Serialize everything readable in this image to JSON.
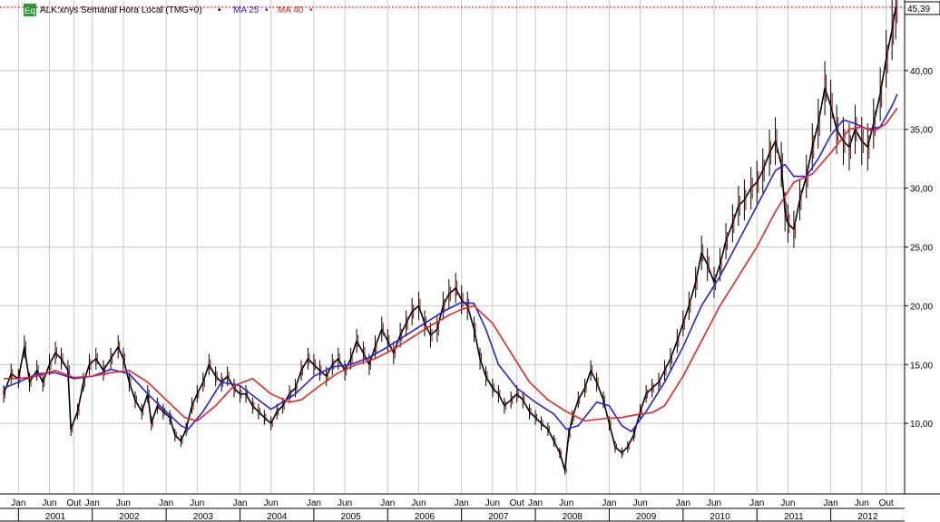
{
  "chart_data": {
    "type": "line",
    "title": "ALK:xnys Semanal Hora Local (TMG+0)",
    "badge": "Eq",
    "last_price": 45.39,
    "last_price_label": "45,39",
    "ylim": [
      4,
      46
    ],
    "y_ticks": [
      10,
      15,
      20,
      25,
      30,
      35,
      40
    ],
    "y_tick_labels": [
      "10,00",
      "15,00",
      "20,00",
      "25,00",
      "30,00",
      "35,00",
      "40,00"
    ],
    "xlim": [
      2000.75,
      2013.0
    ],
    "month_ticks": [
      {
        "label": "Jan",
        "x": 2001.0
      },
      {
        "label": "Jun",
        "x": 2001.42
      },
      {
        "label": "Out",
        "x": 2001.75
      },
      {
        "label": "Jan",
        "x": 2002.0
      },
      {
        "label": "Jun",
        "x": 2002.42
      },
      {
        "label": "Jan",
        "x": 2003.0
      },
      {
        "label": "Jun",
        "x": 2003.42
      },
      {
        "label": "Jan",
        "x": 2004.0
      },
      {
        "label": "Jun",
        "x": 2004.42
      },
      {
        "label": "Jan",
        "x": 2005.0
      },
      {
        "label": "Jun",
        "x": 2005.42
      },
      {
        "label": "Jan",
        "x": 2006.0
      },
      {
        "label": "Jun",
        "x": 2006.42
      },
      {
        "label": "Jan",
        "x": 2007.0
      },
      {
        "label": "Jun",
        "x": 2007.42
      },
      {
        "label": "Out",
        "x": 2007.75
      },
      {
        "label": "Jan",
        "x": 2008.0
      },
      {
        "label": "Jun",
        "x": 2008.42
      },
      {
        "label": "Jan",
        "x": 2009.0
      },
      {
        "label": "Jun",
        "x": 2009.42
      },
      {
        "label": "Jan",
        "x": 2010.0
      },
      {
        "label": "Jun",
        "x": 2010.42
      },
      {
        "label": "Jan",
        "x": 2011.0
      },
      {
        "label": "Jun",
        "x": 2011.42
      },
      {
        "label": "Jan",
        "x": 2012.0
      },
      {
        "label": "Jun",
        "x": 2012.42
      },
      {
        "label": "Out",
        "x": 2012.75
      }
    ],
    "years": [
      "2001",
      "2002",
      "2003",
      "2004",
      "2005",
      "2006",
      "2007",
      "2008",
      "2009",
      "2010",
      "2011",
      "2012"
    ],
    "series": [
      {
        "name": "ALK:xnys",
        "style": "bars",
        "color": "#000000",
        "points": [
          [
            2000.8,
            12.5
          ],
          [
            2000.9,
            14.2
          ],
          [
            2001.0,
            13.8
          ],
          [
            2001.08,
            16.5
          ],
          [
            2001.15,
            13.5
          ],
          [
            2001.25,
            14.5
          ],
          [
            2001.33,
            13.5
          ],
          [
            2001.42,
            15.0
          ],
          [
            2001.5,
            16.0
          ],
          [
            2001.58,
            15.5
          ],
          [
            2001.67,
            14.5
          ],
          [
            2001.71,
            9.5
          ],
          [
            2001.8,
            11.0
          ],
          [
            2001.88,
            13.5
          ],
          [
            2001.96,
            15.0
          ],
          [
            2002.05,
            15.5
          ],
          [
            2002.15,
            14.5
          ],
          [
            2002.25,
            15.5
          ],
          [
            2002.35,
            16.5
          ],
          [
            2002.42,
            15.5
          ],
          [
            2002.5,
            13.5
          ],
          [
            2002.58,
            12.0
          ],
          [
            2002.67,
            11.0
          ],
          [
            2002.75,
            12.5
          ],
          [
            2002.8,
            10.0
          ],
          [
            2002.88,
            11.5
          ],
          [
            2002.96,
            11.0
          ],
          [
            2003.05,
            10.5
          ],
          [
            2003.12,
            9.0
          ],
          [
            2003.2,
            8.5
          ],
          [
            2003.27,
            9.5
          ],
          [
            2003.35,
            11.5
          ],
          [
            2003.42,
            12.5
          ],
          [
            2003.5,
            13.5
          ],
          [
            2003.58,
            15.0
          ],
          [
            2003.67,
            14.0
          ],
          [
            2003.75,
            13.5
          ],
          [
            2003.83,
            14.0
          ],
          [
            2003.92,
            13.0
          ],
          [
            2004.0,
            12.5
          ],
          [
            2004.08,
            12.5
          ],
          [
            2004.17,
            11.5
          ],
          [
            2004.25,
            11.0
          ],
          [
            2004.33,
            10.5
          ],
          [
            2004.42,
            10.0
          ],
          [
            2004.5,
            11.0
          ],
          [
            2004.58,
            11.5
          ],
          [
            2004.67,
            12.5
          ],
          [
            2004.75,
            13.0
          ],
          [
            2004.83,
            14.5
          ],
          [
            2004.92,
            15.5
          ],
          [
            2005.0,
            15.0
          ],
          [
            2005.08,
            14.5
          ],
          [
            2005.17,
            14.0
          ],
          [
            2005.25,
            15.0
          ],
          [
            2005.33,
            15.5
          ],
          [
            2005.42,
            14.5
          ],
          [
            2005.5,
            15.5
          ],
          [
            2005.58,
            17.0
          ],
          [
            2005.67,
            16.0
          ],
          [
            2005.75,
            15.0
          ],
          [
            2005.83,
            16.5
          ],
          [
            2005.92,
            18.0
          ],
          [
            2006.0,
            17.0
          ],
          [
            2006.08,
            16.0
          ],
          [
            2006.17,
            17.5
          ],
          [
            2006.25,
            18.5
          ],
          [
            2006.33,
            19.5
          ],
          [
            2006.42,
            20.0
          ],
          [
            2006.5,
            18.5
          ],
          [
            2006.58,
            17.5
          ],
          [
            2006.67,
            18.0
          ],
          [
            2006.75,
            20.0
          ],
          [
            2006.83,
            21.0
          ],
          [
            2006.92,
            21.5
          ],
          [
            2007.0,
            20.5
          ],
          [
            2007.08,
            20.0
          ],
          [
            2007.17,
            18.0
          ],
          [
            2007.25,
            15.5
          ],
          [
            2007.33,
            14.0
          ],
          [
            2007.42,
            13.0
          ],
          [
            2007.5,
            12.5
          ],
          [
            2007.58,
            11.5
          ],
          [
            2007.67,
            12.0
          ],
          [
            2007.75,
            12.5
          ],
          [
            2007.83,
            12.0
          ],
          [
            2007.92,
            11.0
          ],
          [
            2008.0,
            10.5
          ],
          [
            2008.08,
            10.0
          ],
          [
            2008.17,
            9.5
          ],
          [
            2008.25,
            8.5
          ],
          [
            2008.33,
            7.5
          ],
          [
            2008.4,
            6.0
          ],
          [
            2008.45,
            9.0
          ],
          [
            2008.5,
            10.5
          ],
          [
            2008.58,
            12.0
          ],
          [
            2008.67,
            13.0
          ],
          [
            2008.75,
            14.5
          ],
          [
            2008.83,
            13.5
          ],
          [
            2008.92,
            12.0
          ],
          [
            2009.0,
            10.0
          ],
          [
            2009.08,
            8.0
          ],
          [
            2009.17,
            7.5
          ],
          [
            2009.25,
            8.0
          ],
          [
            2009.33,
            9.0
          ],
          [
            2009.42,
            11.0
          ],
          [
            2009.5,
            12.5
          ],
          [
            2009.58,
            13.0
          ],
          [
            2009.67,
            13.5
          ],
          [
            2009.75,
            14.5
          ],
          [
            2009.83,
            15.5
          ],
          [
            2009.92,
            17.0
          ],
          [
            2010.0,
            18.5
          ],
          [
            2010.08,
            20.0
          ],
          [
            2010.17,
            22.0
          ],
          [
            2010.25,
            24.5
          ],
          [
            2010.33,
            23.5
          ],
          [
            2010.42,
            22.0
          ],
          [
            2010.5,
            23.5
          ],
          [
            2010.58,
            25.5
          ],
          [
            2010.67,
            27.0
          ],
          [
            2010.75,
            28.5
          ],
          [
            2010.83,
            29.0
          ],
          [
            2010.92,
            30.0
          ],
          [
            2011.0,
            30.5
          ],
          [
            2011.08,
            31.5
          ],
          [
            2011.17,
            33.0
          ],
          [
            2011.25,
            34.0
          ],
          [
            2011.33,
            32.0
          ],
          [
            2011.38,
            28.0
          ],
          [
            2011.42,
            27.0
          ],
          [
            2011.5,
            26.5
          ],
          [
            2011.58,
            29.0
          ],
          [
            2011.67,
            31.0
          ],
          [
            2011.75,
            33.5
          ],
          [
            2011.83,
            35.5
          ],
          [
            2011.92,
            38.5
          ],
          [
            2012.0,
            37.0
          ],
          [
            2012.08,
            35.0
          ],
          [
            2012.17,
            34.0
          ],
          [
            2012.25,
            33.5
          ],
          [
            2012.33,
            35.0
          ],
          [
            2012.42,
            34.0
          ],
          [
            2012.5,
            33.5
          ],
          [
            2012.58,
            35.5
          ],
          [
            2012.67,
            38.0
          ],
          [
            2012.75,
            41.0
          ],
          [
            2012.83,
            43.5
          ],
          [
            2012.88,
            45.39
          ]
        ]
      },
      {
        "name": "MA 25",
        "style": "line",
        "color": "#2222dd",
        "points": [
          [
            2000.8,
            13.0
          ],
          [
            2001.0,
            13.5
          ],
          [
            2001.25,
            14.2
          ],
          [
            2001.5,
            14.3
          ],
          [
            2001.75,
            13.8
          ],
          [
            2002.0,
            14.0
          ],
          [
            2002.25,
            14.6
          ],
          [
            2002.5,
            14.2
          ],
          [
            2002.75,
            12.5
          ],
          [
            2003.0,
            11.0
          ],
          [
            2003.2,
            9.8
          ],
          [
            2003.3,
            9.5
          ],
          [
            2003.5,
            11.0
          ],
          [
            2003.75,
            13.5
          ],
          [
            2004.0,
            13.2
          ],
          [
            2004.25,
            12.0
          ],
          [
            2004.42,
            11.2
          ],
          [
            2004.5,
            11.5
          ],
          [
            2004.75,
            12.5
          ],
          [
            2005.0,
            14.0
          ],
          [
            2005.25,
            14.8
          ],
          [
            2005.5,
            15.0
          ],
          [
            2005.75,
            15.6
          ],
          [
            2006.0,
            16.5
          ],
          [
            2006.25,
            17.5
          ],
          [
            2006.5,
            18.5
          ],
          [
            2006.75,
            19.5
          ],
          [
            2007.0,
            20.3
          ],
          [
            2007.17,
            20.2
          ],
          [
            2007.33,
            18.0
          ],
          [
            2007.5,
            15.0
          ],
          [
            2007.75,
            13.0
          ],
          [
            2008.0,
            11.8
          ],
          [
            2008.25,
            10.8
          ],
          [
            2008.42,
            9.5
          ],
          [
            2008.58,
            9.8
          ],
          [
            2008.83,
            11.8
          ],
          [
            2009.0,
            11.5
          ],
          [
            2009.17,
            9.8
          ],
          [
            2009.3,
            9.3
          ],
          [
            2009.5,
            11.0
          ],
          [
            2009.75,
            13.5
          ],
          [
            2010.0,
            16.5
          ],
          [
            2010.25,
            20.0
          ],
          [
            2010.5,
            22.5
          ],
          [
            2010.75,
            25.5
          ],
          [
            2011.0,
            28.5
          ],
          [
            2011.25,
            31.5
          ],
          [
            2011.38,
            32.0
          ],
          [
            2011.5,
            31.0
          ],
          [
            2011.67,
            31.0
          ],
          [
            2011.83,
            32.5
          ],
          [
            2012.0,
            34.5
          ],
          [
            2012.17,
            35.8
          ],
          [
            2012.33,
            35.5
          ],
          [
            2012.5,
            35.0
          ],
          [
            2012.67,
            35.2
          ],
          [
            2012.83,
            37.0
          ],
          [
            2012.9,
            38.0
          ]
        ]
      },
      {
        "name": "MA 40",
        "style": "line",
        "color": "#ee2222",
        "points": [
          [
            2000.8,
            13.8
          ],
          [
            2001.0,
            13.8
          ],
          [
            2001.25,
            14.0
          ],
          [
            2001.5,
            14.5
          ],
          [
            2001.75,
            13.9
          ],
          [
            2002.0,
            14.0
          ],
          [
            2002.25,
            14.3
          ],
          [
            2002.5,
            14.5
          ],
          [
            2002.75,
            13.5
          ],
          [
            2003.0,
            12.0
          ],
          [
            2003.25,
            10.5
          ],
          [
            2003.42,
            10.2
          ],
          [
            2003.67,
            11.5
          ],
          [
            2003.92,
            13.2
          ],
          [
            2004.17,
            13.8
          ],
          [
            2004.42,
            12.5
          ],
          [
            2004.67,
            11.8
          ],
          [
            2004.83,
            12.0
          ],
          [
            2005.08,
            13.2
          ],
          [
            2005.33,
            14.3
          ],
          [
            2005.58,
            15.0
          ],
          [
            2005.83,
            15.5
          ],
          [
            2006.08,
            16.3
          ],
          [
            2006.33,
            17.3
          ],
          [
            2006.58,
            18.3
          ],
          [
            2006.83,
            19.2
          ],
          [
            2007.0,
            19.7
          ],
          [
            2007.17,
            20.0
          ],
          [
            2007.42,
            18.5
          ],
          [
            2007.67,
            16.0
          ],
          [
            2007.92,
            13.5
          ],
          [
            2008.17,
            12.0
          ],
          [
            2008.42,
            11.0
          ],
          [
            2008.67,
            10.2
          ],
          [
            2008.92,
            10.4
          ],
          [
            2009.17,
            10.5
          ],
          [
            2009.42,
            10.8
          ],
          [
            2009.58,
            10.9
          ],
          [
            2009.75,
            11.5
          ],
          [
            2010.0,
            14.0
          ],
          [
            2010.25,
            17.0
          ],
          [
            2010.5,
            20.0
          ],
          [
            2010.75,
            22.5
          ],
          [
            2011.0,
            25.0
          ],
          [
            2011.25,
            28.0
          ],
          [
            2011.5,
            30.5
          ],
          [
            2011.75,
            31.2
          ],
          [
            2012.0,
            33.0
          ],
          [
            2012.25,
            35.0
          ],
          [
            2012.42,
            35.2
          ],
          [
            2012.58,
            34.8
          ],
          [
            2012.75,
            35.5
          ],
          [
            2012.9,
            36.8
          ]
        ]
      }
    ]
  }
}
